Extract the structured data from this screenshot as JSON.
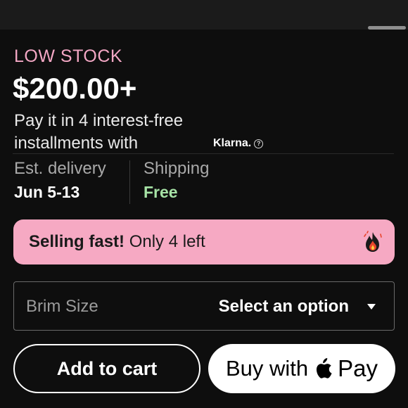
{
  "stock": {
    "status": "LOW STOCK"
  },
  "price": {
    "value": "$200.00+"
  },
  "installments": {
    "line1": "Pay it in 4 interest-free",
    "line2": "installments with",
    "provider": "Klarna.",
    "help_icon": "?"
  },
  "delivery": {
    "label": "Est. delivery",
    "value": "Jun 5-13"
  },
  "shipping": {
    "label": "Shipping",
    "value": "Free"
  },
  "urgency": {
    "strong": "Selling fast!",
    "text": "Only 4 left",
    "icon": "fire-icon"
  },
  "option_select": {
    "label": "Brim Size",
    "value": "Select an option"
  },
  "actions": {
    "add_to_cart": "Add to cart",
    "apple_pay_prefix": "Buy with",
    "apple_pay_suffix": "Pay"
  },
  "colors": {
    "background": "#0e0e0e",
    "low_stock": "#f3a7c4",
    "free_shipping": "#a7e3a6",
    "banner": "#f6a9c3"
  }
}
